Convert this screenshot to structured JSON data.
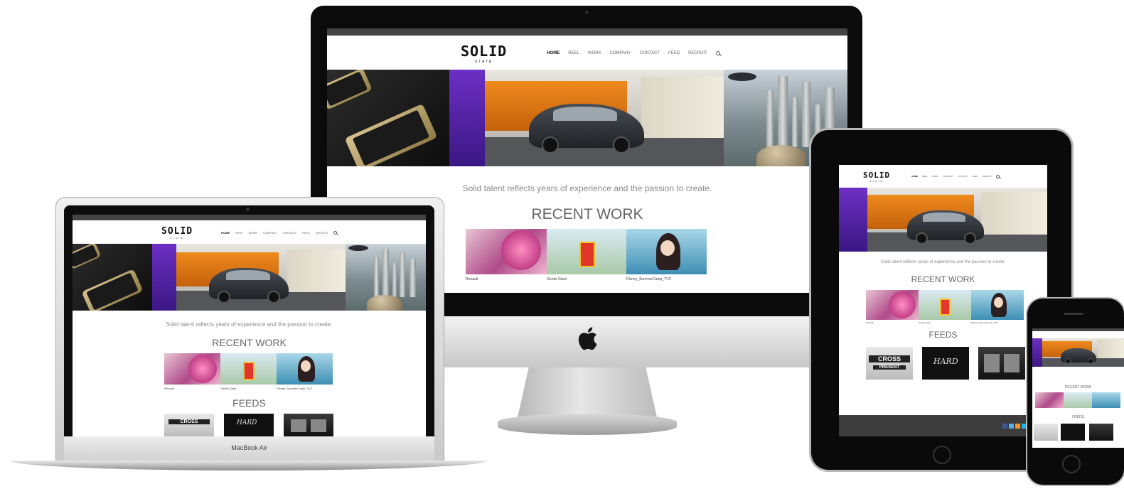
{
  "site": {
    "logo_main": "SOLID",
    "logo_sub": "STATE",
    "nav": [
      "HOME",
      "REEL",
      "WORK",
      "COMPANY",
      "CONTACT",
      "FEED",
      "RECRUIT"
    ],
    "tagline": "Solid talent reflects years of experience and the passion to create.",
    "recent_heading": "RECENT WORK",
    "feeds_heading": "FEEDS",
    "recent_captions": [
      "Renault",
      "Gentle Giant",
      "Disney_SummerCamp_TVC"
    ],
    "feed_text": [
      "CROSS",
      "PRESENT",
      "HARD"
    ]
  },
  "devices": {
    "laptop_label": "MacBook Air"
  },
  "colors": {
    "accent_orange": "#ef8a1c",
    "accent_purple": "#6d2fc4",
    "header_strip": "#444444",
    "footer": "#3c3c3c"
  }
}
